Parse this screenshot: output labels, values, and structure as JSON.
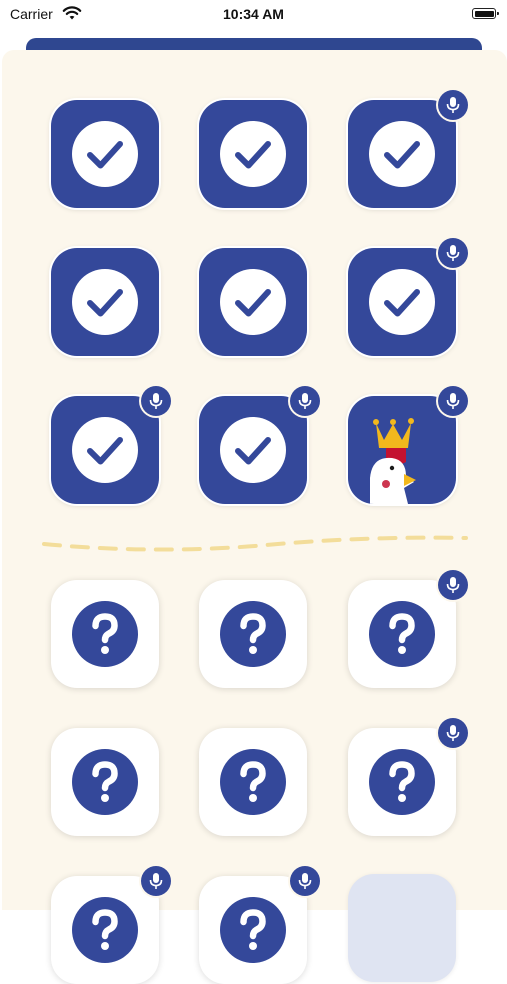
{
  "status_bar": {
    "carrier": "Carrier",
    "time": "10:34 AM",
    "wifi_icon": "wifi-icon",
    "battery_icon": "battery-icon"
  },
  "colors": {
    "primary": "#34489a",
    "background": "#fcf7ec",
    "divider": "#f3dd9a",
    "crown": "#f2b81d",
    "comb": "#c41230"
  },
  "levels": {
    "completed": [
      {
        "id": 1,
        "status": "completed",
        "icon": "check-icon",
        "audio": false
      },
      {
        "id": 2,
        "status": "completed",
        "icon": "check-icon",
        "audio": false
      },
      {
        "id": 3,
        "status": "completed",
        "icon": "check-icon",
        "audio": true
      },
      {
        "id": 4,
        "status": "completed",
        "icon": "check-icon",
        "audio": false
      },
      {
        "id": 5,
        "status": "completed",
        "icon": "check-icon",
        "audio": false
      },
      {
        "id": 6,
        "status": "completed",
        "icon": "check-icon",
        "audio": true
      },
      {
        "id": 7,
        "status": "completed",
        "icon": "check-icon",
        "audio": true
      },
      {
        "id": 8,
        "status": "completed",
        "icon": "check-icon",
        "audio": true
      },
      {
        "id": 9,
        "status": "boss",
        "icon": "crowned-chicken-icon",
        "audio": true
      }
    ],
    "locked": [
      {
        "id": 10,
        "status": "locked",
        "icon": "question-icon",
        "audio": false
      },
      {
        "id": 11,
        "status": "locked",
        "icon": "question-icon",
        "audio": false
      },
      {
        "id": 12,
        "status": "locked",
        "icon": "question-icon",
        "audio": true
      },
      {
        "id": 13,
        "status": "locked",
        "icon": "question-icon",
        "audio": false
      },
      {
        "id": 14,
        "status": "locked",
        "icon": "question-icon",
        "audio": false
      },
      {
        "id": 15,
        "status": "locked",
        "icon": "question-icon",
        "audio": true
      },
      {
        "id": 16,
        "status": "locked",
        "icon": "question-icon",
        "audio": true
      },
      {
        "id": 17,
        "status": "locked",
        "icon": "question-icon",
        "audio": true
      },
      {
        "id": 18,
        "status": "upcoming",
        "icon": "",
        "audio": false
      }
    ]
  }
}
